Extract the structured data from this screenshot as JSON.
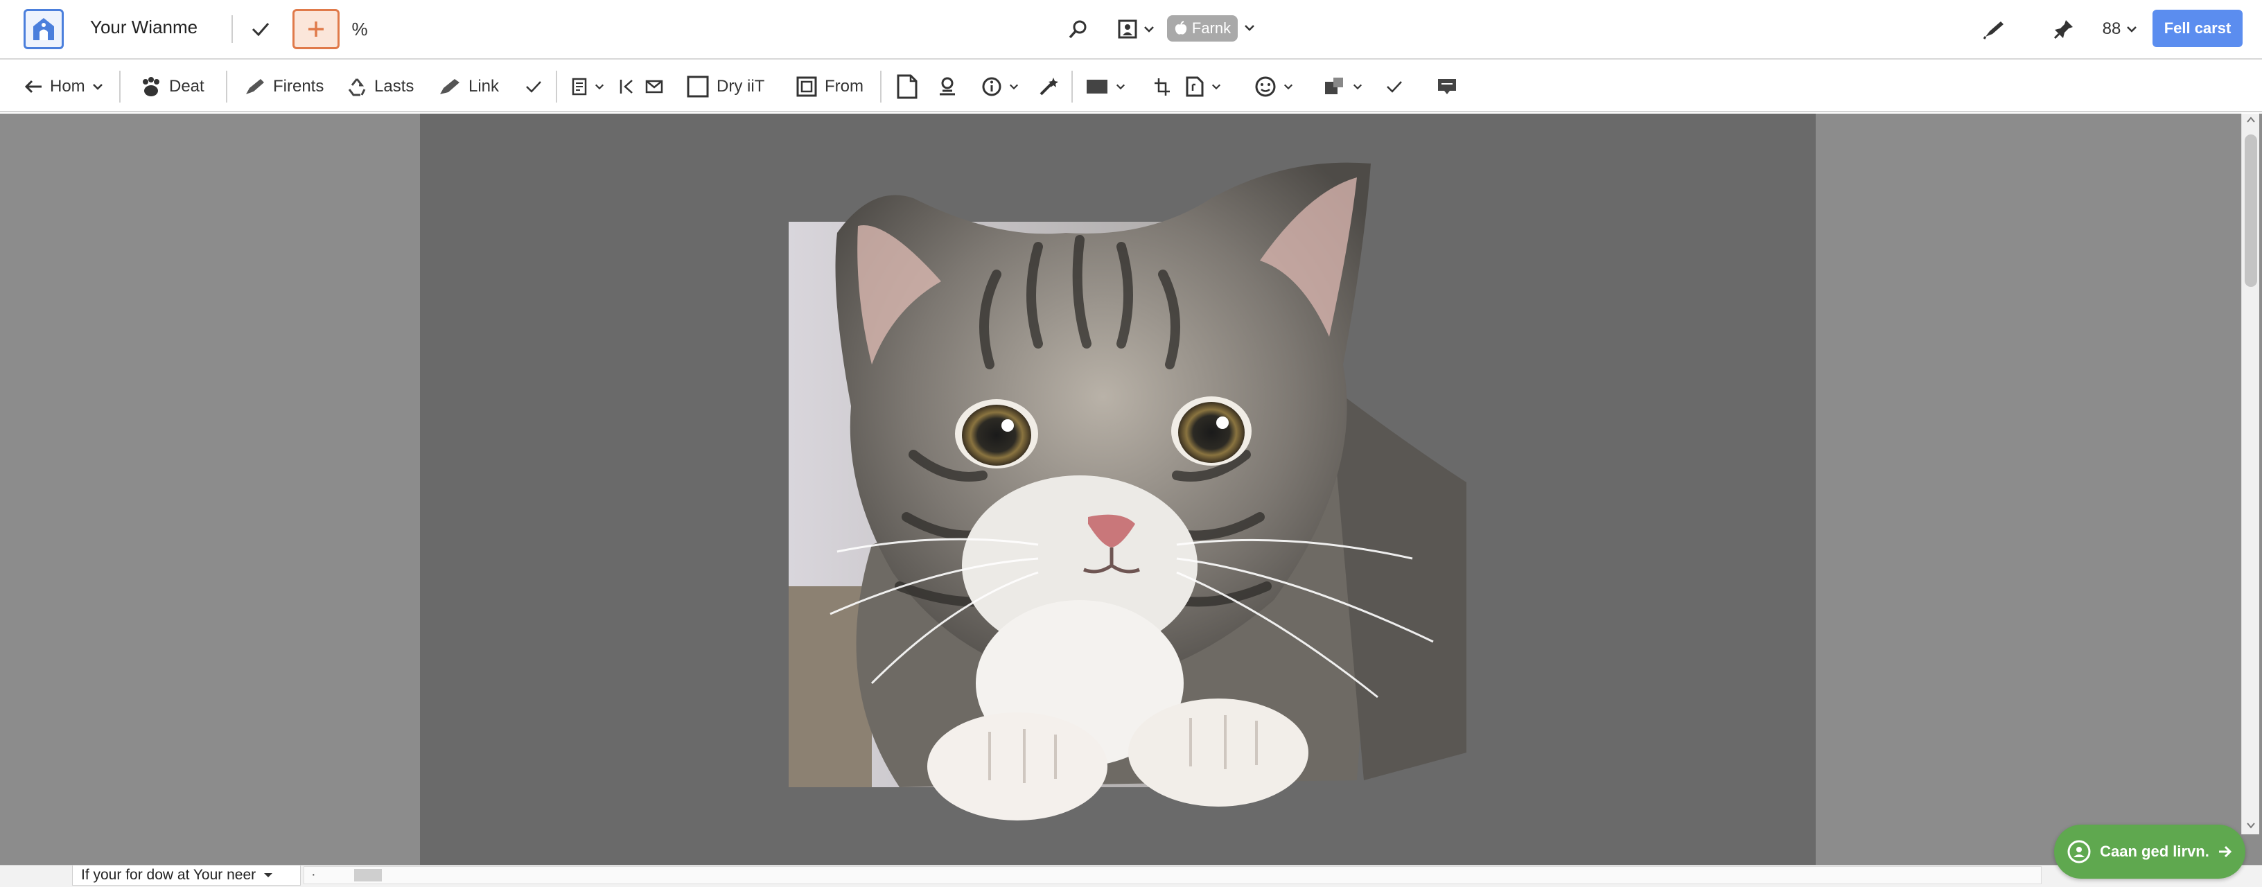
{
  "app": {
    "doc_title": "Your Wianme",
    "percent_label": "%",
    "pill_label": "Farnk",
    "zoom_value": "88",
    "primary_button": "Fell carst"
  },
  "toolbar": {
    "items": [
      {
        "label": "Hom",
        "icon": "arrow-left-icon"
      },
      {
        "label": "Deat",
        "icon": "paw-icon"
      },
      {
        "label": "Firents",
        "icon": "pen-icon"
      },
      {
        "label": "Lasts",
        "icon": "recycle-icon"
      },
      {
        "label": "Link",
        "icon": "link-icon"
      },
      {
        "label": "Dry iiT",
        "icon": "checkbox-icon"
      },
      {
        "label": "From",
        "icon": "frame-icon"
      }
    ]
  },
  "status": {
    "select_value": "If your for dow at Your neer",
    "mid_text": "·"
  },
  "fab": {
    "label": "Caan ged lirvn."
  },
  "colors": {
    "accent_blue": "#5b8def",
    "accent_orange": "#e07a4a",
    "accent_green": "#5fa84f",
    "canvas_gray": "#6a6a6a"
  }
}
